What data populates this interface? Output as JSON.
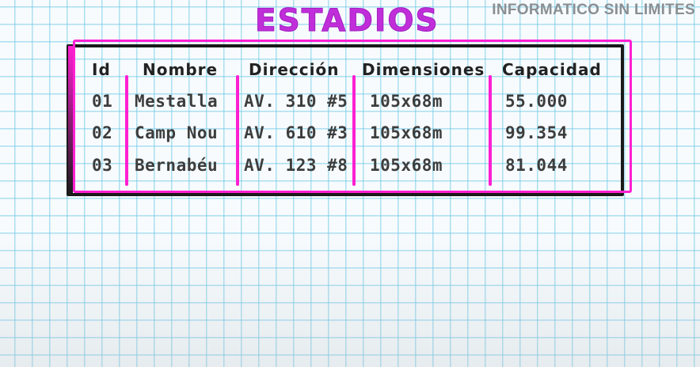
{
  "brand": "INFORMATICO SIN LIMITES",
  "title": "ESTADIOS",
  "table": {
    "headers": [
      "Id",
      "Nombre",
      "Dirección",
      "Dimensiones",
      "Capacidad"
    ],
    "rows": [
      [
        "01",
        "Mestalla",
        "AV. 310 #5",
        "105x68m",
        "55.000"
      ],
      [
        "02",
        "Camp Nou",
        "AV. 610 #3",
        "105x68m",
        "99.354"
      ],
      [
        "03",
        "Bernabéu",
        "AV. 123 #8",
        "105x68m",
        "81.044"
      ]
    ]
  },
  "colors": {
    "title": "#c02ed9",
    "frame_pink": "#ff1fd2",
    "frame_black": "#1a1a1a",
    "grid": "#6ec8e6"
  }
}
